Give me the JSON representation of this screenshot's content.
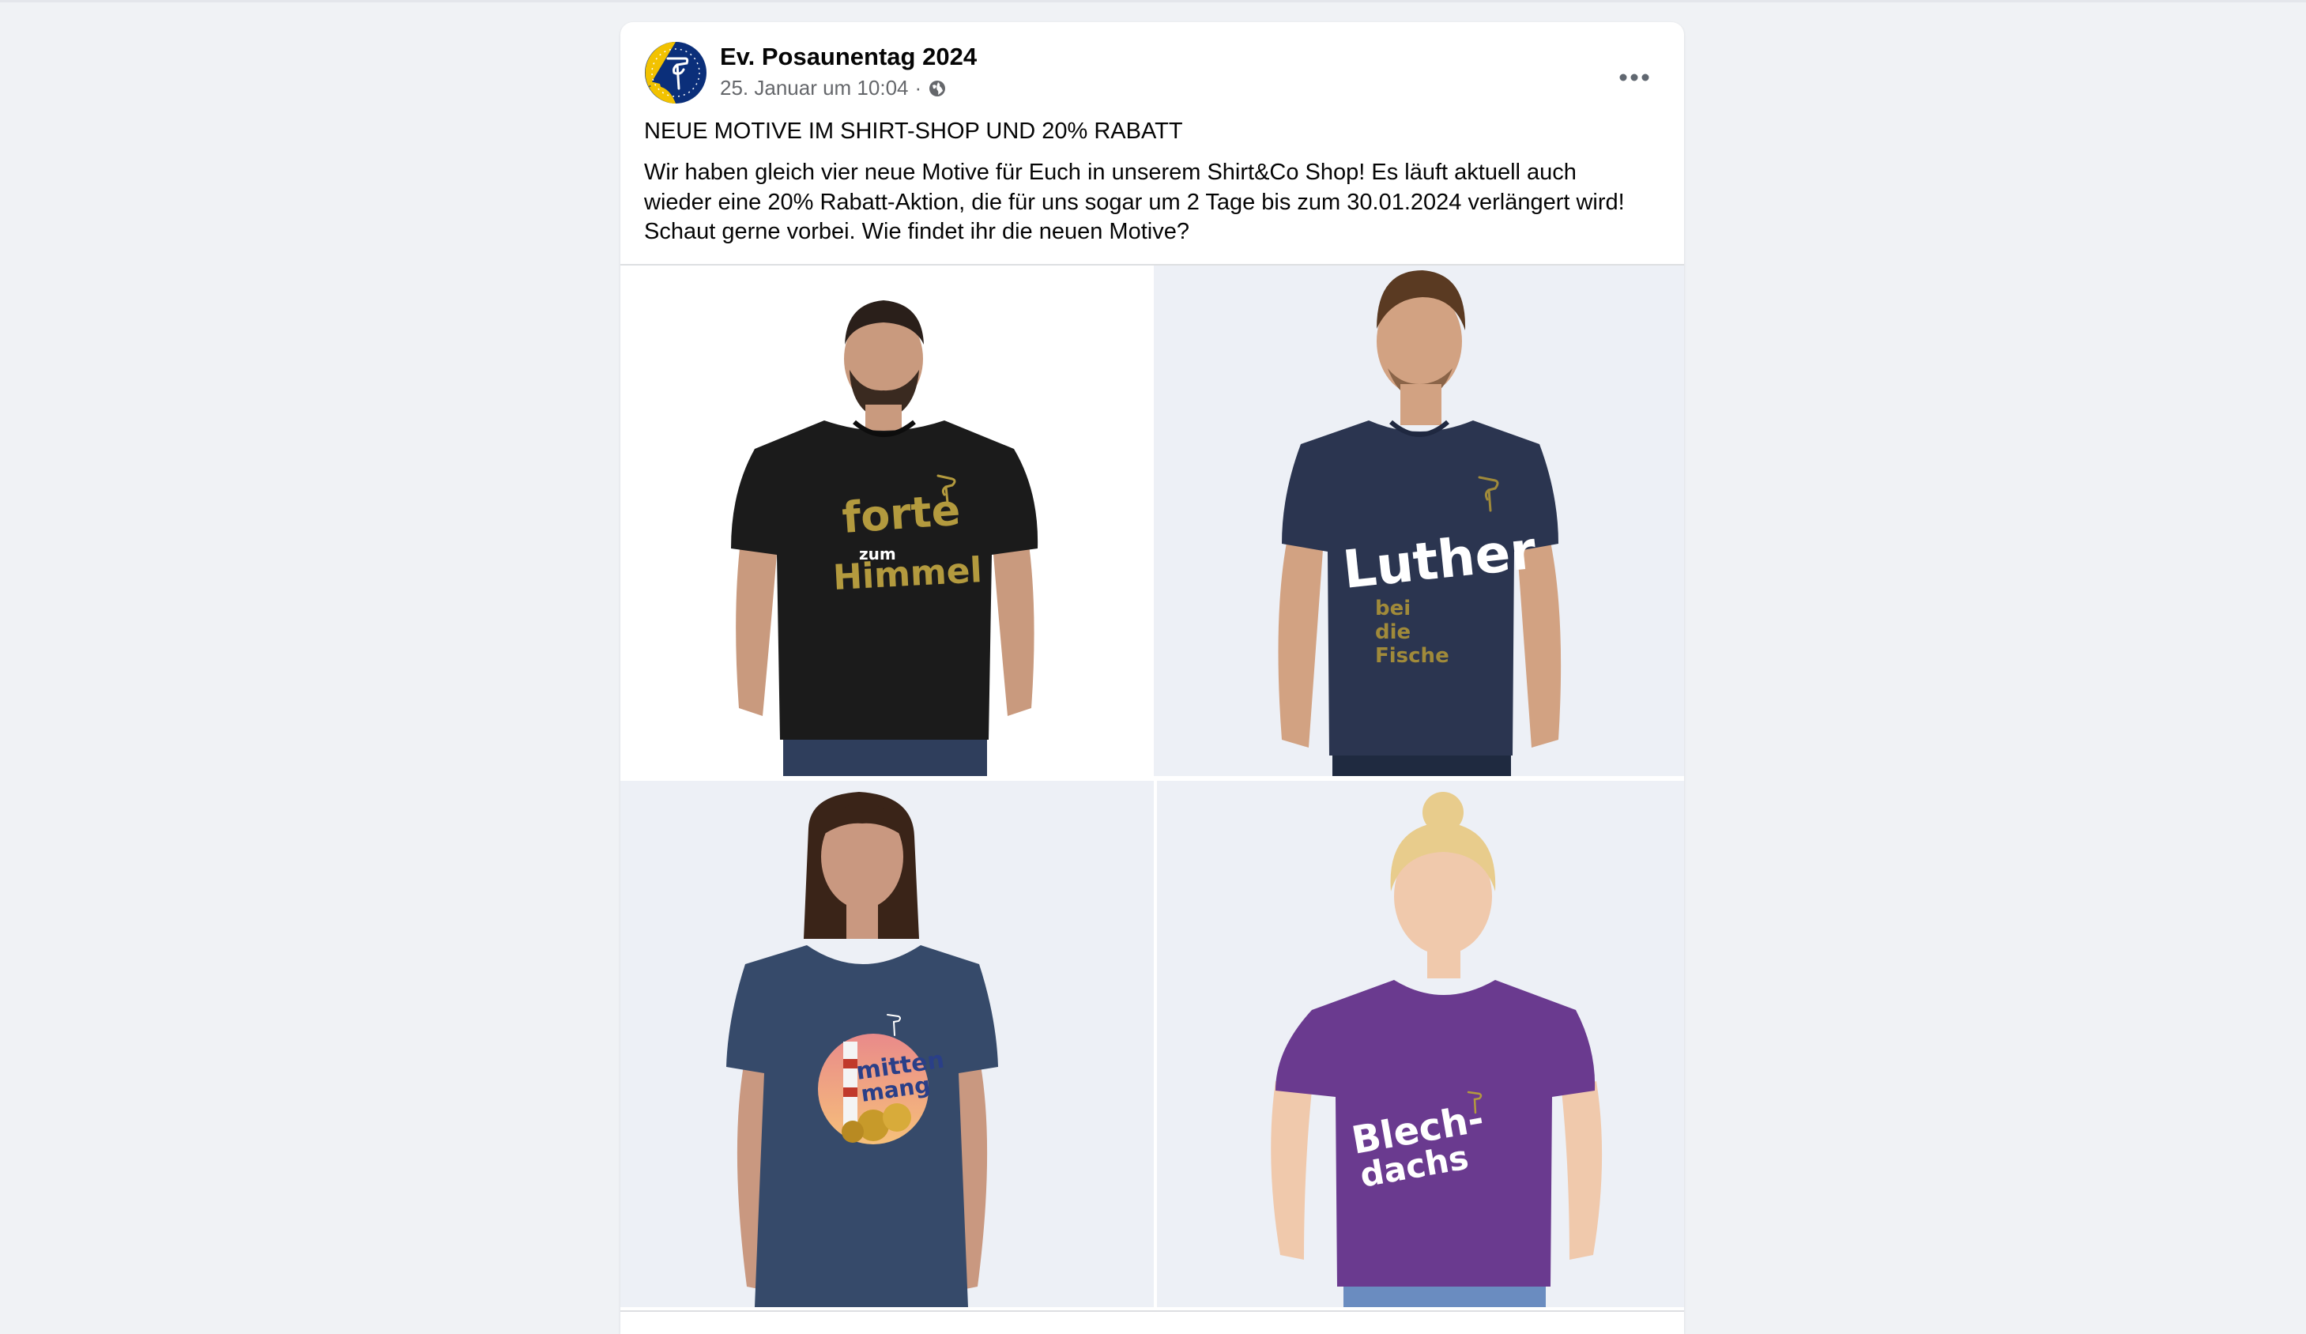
{
  "post": {
    "page_name": "Ev. Posaunentag 2024",
    "timestamp": "25. Januar um 10:04",
    "separator": "·",
    "audience_icon": "globe-icon",
    "more_icon": "more-options-icon",
    "headline": "NEUE MOTIVE IM SHIRT-SHOP UND 20% RABATT",
    "text": "Wir haben gleich vier neue Motive für Euch in unserem Shirt&Co Shop! Es läuft aktuell auch wieder eine 20% Rabatt-Aktion, die für uns sogar um 2 Tage bis zum 30.01.2024 verlängert wird! Schaut gerne vorbei. Wie findet ihr die neuen Motive?"
  },
  "photos": [
    {
      "print_lines": [
        "forte",
        "zum",
        "Himmel"
      ],
      "shirt_color": "#1b1b1b",
      "print_color": "#b39a3e"
    },
    {
      "print_lines": [
        "Luther",
        "bei",
        "die",
        "Fische"
      ],
      "shirt_color": "#2b3550",
      "print_color": "#a08a3a"
    },
    {
      "print_lines": [
        "mitten",
        "mang"
      ],
      "shirt_color": "#364a6a",
      "print_color": "#2a3f88"
    },
    {
      "print_lines": [
        "Blech-",
        "dachs"
      ],
      "shirt_color": "#6a3a8f",
      "print_color": "#ffffff"
    }
  ]
}
